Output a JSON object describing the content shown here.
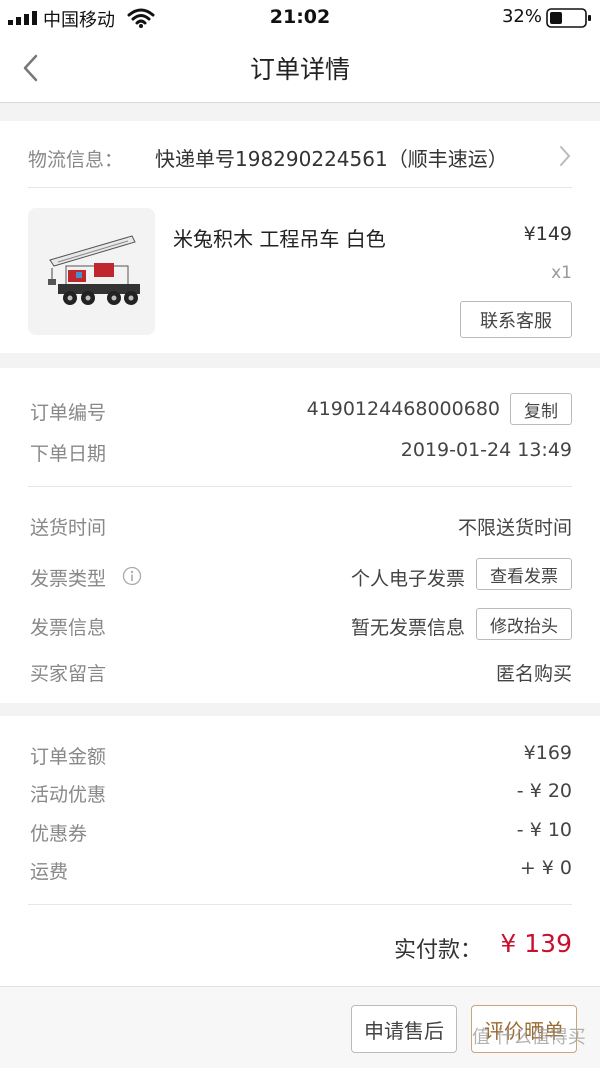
{
  "status_bar": {
    "carrier": "中国移动",
    "time": "21:02",
    "battery": "32%"
  },
  "nav": {
    "title": "订单详情"
  },
  "logistics": {
    "label": "物流信息：",
    "value": "快递单号198290224561（顺丰速运）"
  },
  "product": {
    "name": "米兔积木 工程吊车 白色",
    "price": "¥149",
    "quantity": "x1",
    "service_button": "联系客服"
  },
  "order_info": {
    "order_no_label": "订单编号",
    "order_no": "4190124468000680",
    "copy_button": "复制",
    "date_label": "下单日期",
    "date": "2019-01-24 13:49",
    "delivery_label": "送货时间",
    "delivery": "不限送货时间",
    "invoice_type_label": "发票类型",
    "invoice_type": "个人电子发票",
    "view_invoice_button": "查看发票",
    "invoice_info_label": "发票信息",
    "invoice_info": "暂无发票信息",
    "edit_header_button": "修改抬头",
    "message_label": "买家留言",
    "message": "匿名购买"
  },
  "amounts": {
    "order_amount_label": "订单金额",
    "order_amount": "¥169",
    "promo_label": "活动优惠",
    "promo": "- ¥ 20",
    "coupon_label": "优惠券",
    "coupon": "- ¥ 10",
    "shipping_label": "运费",
    "shipping": "+ ¥ 0",
    "paid_label": "实付款：",
    "paid": "¥ 139"
  },
  "actions": {
    "after_sale": "申请售后",
    "review": "评价晒单"
  },
  "watermark": "值 什么值得买",
  "colors": {
    "accent_red": "#c8102e",
    "review_gold": "#9b6b2f"
  },
  "icons": [
    "signal-icon",
    "wifi-icon",
    "battery-icon",
    "back-chevron-icon",
    "chevron-right-icon",
    "info-icon"
  ]
}
